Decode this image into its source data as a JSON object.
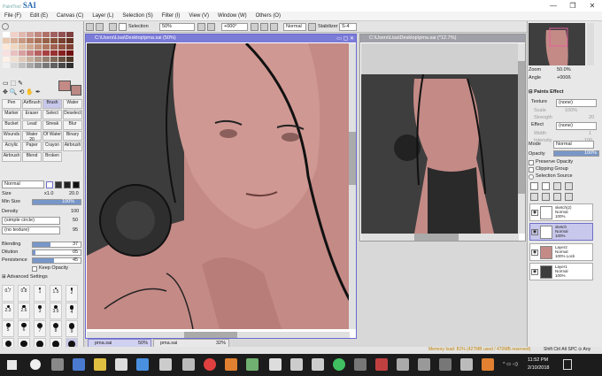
{
  "app": {
    "logo_small": "PaintTool",
    "logo": "SAI",
    "window_controls": [
      "—",
      "❐",
      "✕"
    ]
  },
  "menu": [
    "File (F)",
    "Edit (E)",
    "Canvas (C)",
    "Layer (L)",
    "Selection (S)",
    "Filter (I)",
    "View (V)",
    "Window (W)",
    "Others (O)"
  ],
  "toolbar": {
    "selection_label": "Selection",
    "zoom": "50%",
    "rotation": "+000°",
    "blend_mode": "Normal",
    "stabilizer_label": "Stabilizer",
    "stabilizer_value": "S-4"
  },
  "tools": {
    "brushes": [
      "Pen",
      "AirBrush",
      "Brush",
      "Water",
      "Marker",
      "Eraser",
      "Select",
      "Deselect",
      "Bucket",
      "Lead",
      "Streak",
      "Blur",
      "Wounds",
      "Water 20",
      "Of Water",
      "Binary",
      "Acrylic",
      "Paper",
      "Crayon",
      "Airbrush",
      "Airbrush",
      "Blend",
      "Broken"
    ],
    "mode": "Normal",
    "size_label": "Size",
    "size_mult": "x1.0",
    "size_value": "20.0",
    "min_size_label": "Min Size",
    "min_size_value": "100%",
    "density_label": "Density",
    "density_value": "100",
    "shape": "(simple circle)",
    "shape_value": "50",
    "texture": "(no texture)",
    "texture_value": "95",
    "blending_label": "Blending",
    "blending_value": "37",
    "dilution_label": "Dilution",
    "dilution_value": "05",
    "persistence_label": "Persistence",
    "persistence_value": "45",
    "keep_opacity": "Keep Opacity",
    "advanced": "Advanced Settings",
    "brush_sizes": [
      "0.7",
      "0.8",
      "1",
      "1.5",
      "2",
      "2.3",
      "2.6",
      "3",
      "3.5",
      "4",
      "5",
      "6",
      "7",
      "8",
      "9",
      "10",
      "12",
      "14",
      "16",
      "20"
    ]
  },
  "documents": {
    "main_title": "C:\\Users\\Lisa\\Desktop\\pma.sai (50%)",
    "second_title": "C:\\Users\\Lisa\\Desktop\\pma.sai (*12.7%)",
    "tabs": [
      {
        "name": "pma.sai",
        "zoom": "50%"
      },
      {
        "name": "pma.sai",
        "zoom": "32%"
      }
    ]
  },
  "navigator": {
    "zoom_label": "Zoom",
    "zoom_value": "50.0%",
    "angle_label": "Angle",
    "angle_value": "+000ß"
  },
  "paints_effect": {
    "header": "Paints Effect",
    "texture_label": "Texture",
    "texture_value": "(none)",
    "scale_label": "Scale",
    "scale_value": "100%",
    "strength_label": "Strength",
    "strength_value": "20",
    "effect_label": "Effect",
    "effect_value": "(none)",
    "width_label": "Width",
    "width_value": "1",
    "intensity_label": "Intensity",
    "intensity_value": "100"
  },
  "layer_props": {
    "mode_label": "Mode",
    "mode_value": "Normal",
    "opacity_label": "Opacity",
    "opacity_value": "100%",
    "preserve": "Preserve Opacity",
    "clipping": "Clipping Group",
    "selection_source": "Selection Source"
  },
  "layers": [
    {
      "name": "sketch(2)",
      "mode": "Normal",
      "opacity": "100%",
      "extra": "",
      "selected": false
    },
    {
      "name": "sketch",
      "mode": "Normal",
      "opacity": "100%",
      "extra": "",
      "selected": true
    },
    {
      "name": "Layer2",
      "mode": "Normal",
      "opacity": "100%",
      "extra": "Lock",
      "selected": false
    },
    {
      "name": "Layer1",
      "mode": "Normal",
      "opacity": "100%",
      "extra": "",
      "selected": false
    }
  ],
  "status": {
    "memory": "Memory load: 81% (427MB used / 470MB reserved)",
    "keys": "Shift Ctrl Alt SPC ⊙ Any"
  },
  "taskbar": {
    "time": "11:52 PM",
    "date": "2/10/2018"
  },
  "colors": {
    "accent": "#7b7bd8",
    "skin": "#c48a86",
    "dark": "#3c3c3c"
  }
}
